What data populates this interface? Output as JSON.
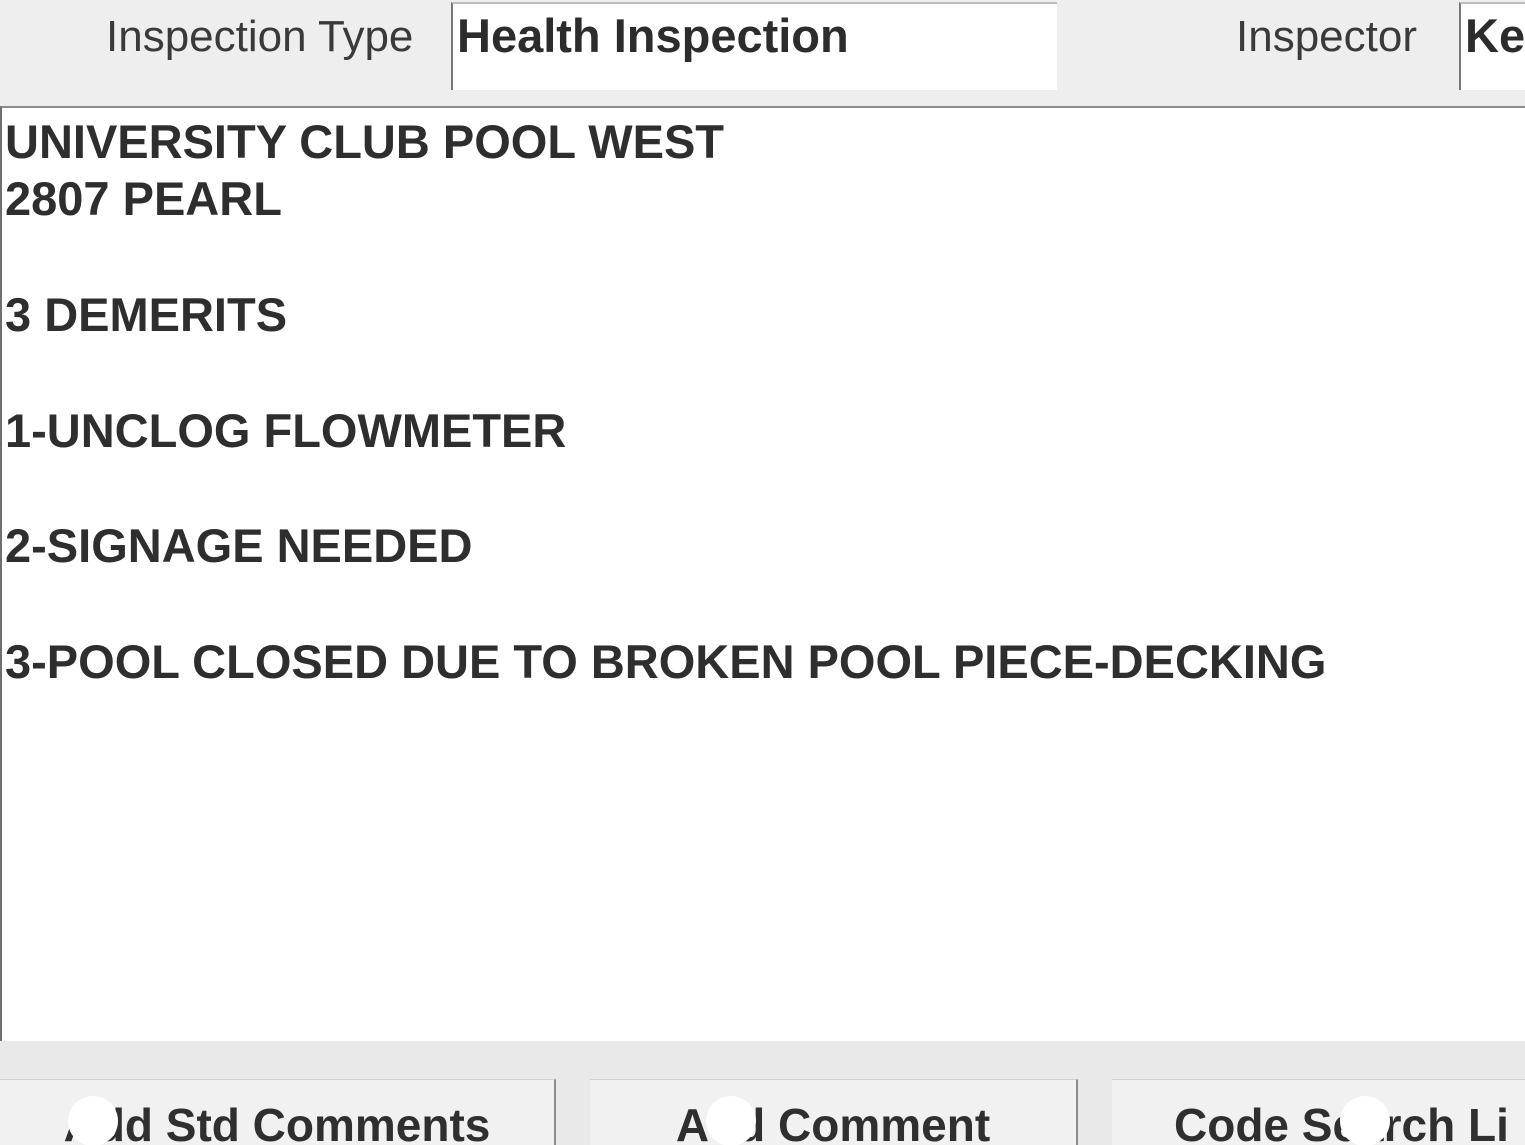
{
  "header": {
    "inspection_type_label": "Inspection Type",
    "inspection_type_value": "Health Inspection",
    "inspector_label": "Inspector",
    "inspector_value": "Ke"
  },
  "comments": {
    "lines": [
      "UNIVERSITY CLUB POOL WEST",
      "2807 PEARL",
      "3 DEMERITS",
      "1-UNCLOG FLOWMETER",
      "2-SIGNAGE NEEDED",
      "3-POOL CLOSED DUE TO BROKEN POOL PIECE-DECKING"
    ]
  },
  "buttons": {
    "std_comments": "Add Std Comments",
    "add_comment": "Add Comment",
    "code_search": "Code Search Li"
  }
}
